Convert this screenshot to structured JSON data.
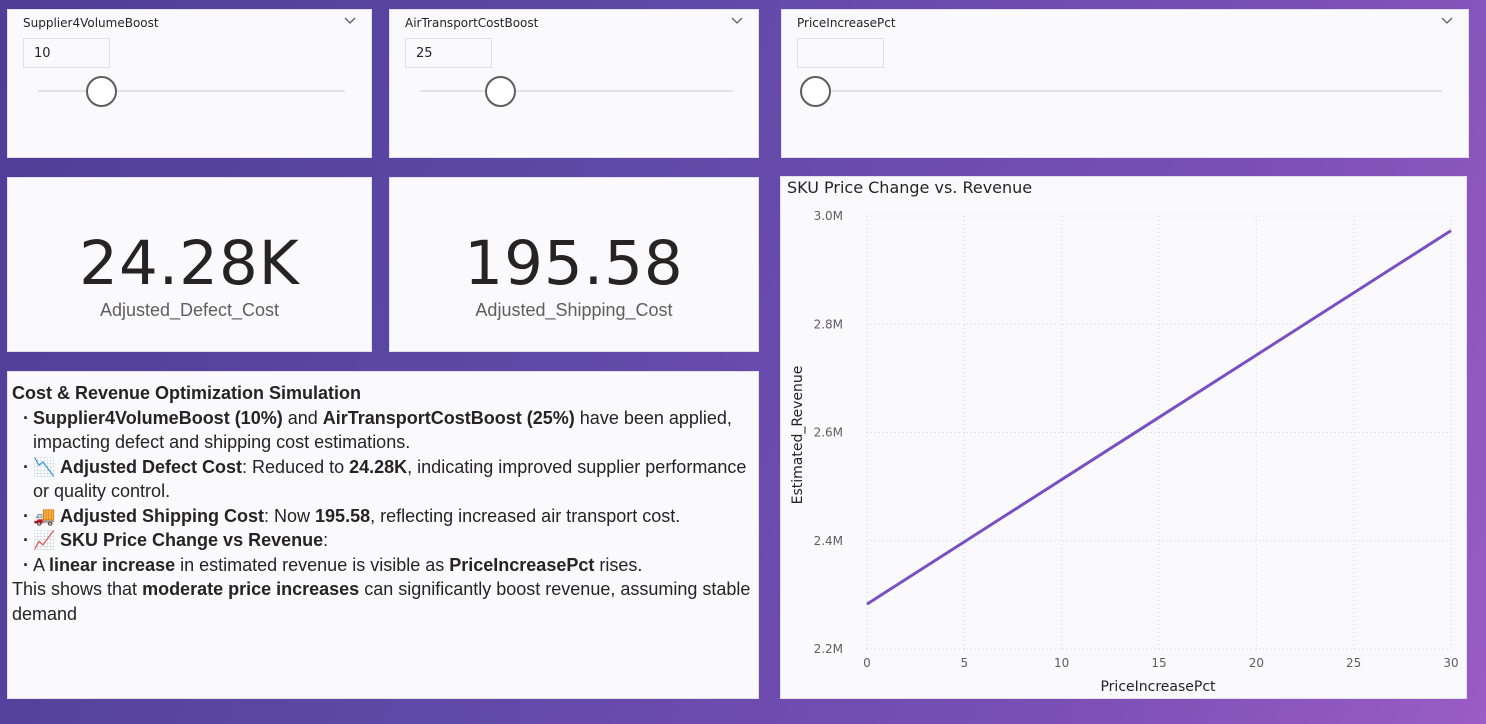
{
  "slicers": [
    {
      "title": "Supplier4VolumeBoost",
      "value": "10",
      "level": 0.2
    },
    {
      "title": "AirTransportCostBoost",
      "value": "25",
      "level": 0.26
    },
    {
      "title": "PriceIncreasePct",
      "value": "",
      "level": 0
    }
  ],
  "icons": {
    "slicer_chevron": "chevron-down-icon",
    "defect_emoji": "chart-decreasing-icon",
    "shipping_emoji": "truck-icon",
    "revenue_emoji": "chart-increasing-icon"
  },
  "kpis": [
    {
      "value": "24.28K",
      "label": "Adjusted_Defect_Cost"
    },
    {
      "value": "195.58",
      "label": "Adjusted_Shipping_Cost"
    }
  ],
  "textbox": {
    "title": "Cost & Revenue Optimization Simulation",
    "b1_bold1": "Supplier4VolumeBoost (10%)",
    "b1_mid": " and ",
    "b1_bold2": "AirTransportCostBoost (25%)",
    "b1_rest": " have been applied, impacting defect and shipping cost estimations.",
    "b2_emoji": "📉",
    "b2_bold": "Adjusted Defect Cost",
    "b2_mid": ": Reduced to ",
    "b2_bold2": "24.28K",
    "b2_rest": ", indicating improved supplier performance or quality control.",
    "b3_emoji": "🚚",
    "b3_bold": "Adjusted Shipping Cost",
    "b3_mid": ": Now ",
    "b3_bold2": "195.58",
    "b3_rest": ", reflecting increased air transport cost.",
    "b4_emoji": "📈",
    "b4_bold": "SKU Price Change vs Revenue",
    "b4_rest": ":",
    "b5_pre": "A ",
    "b5_bold": "linear increase",
    "b5_mid": " in estimated revenue is visible as ",
    "b5_bold2": "PriceIncreasePct",
    "b5_rest": " rises.",
    "p_pre": "This shows that ",
    "p_bold": "moderate price increases",
    "p_rest": " can significantly boost revenue, assuming stable demand"
  },
  "chart_data": {
    "type": "line",
    "title": "SKU Price Change vs. Revenue",
    "xlabel": "PriceIncreasePct",
    "ylabel": "Estimated_Revenue",
    "xlim": [
      0,
      30
    ],
    "ylim": [
      2.2,
      3.0
    ],
    "x_ticks": [
      0,
      5,
      10,
      15,
      20,
      25,
      30
    ],
    "y_ticks": [
      2.2,
      2.4,
      2.6,
      2.8,
      3.0
    ],
    "y_tick_labels": [
      "2.2M",
      "2.4M",
      "2.6M",
      "2.8M",
      "3.0M"
    ],
    "grid": true,
    "color": "#7b4fc4",
    "series": [
      {
        "x": [
          0,
          30
        ],
        "y": [
          2.283,
          2.973
        ]
      }
    ]
  }
}
